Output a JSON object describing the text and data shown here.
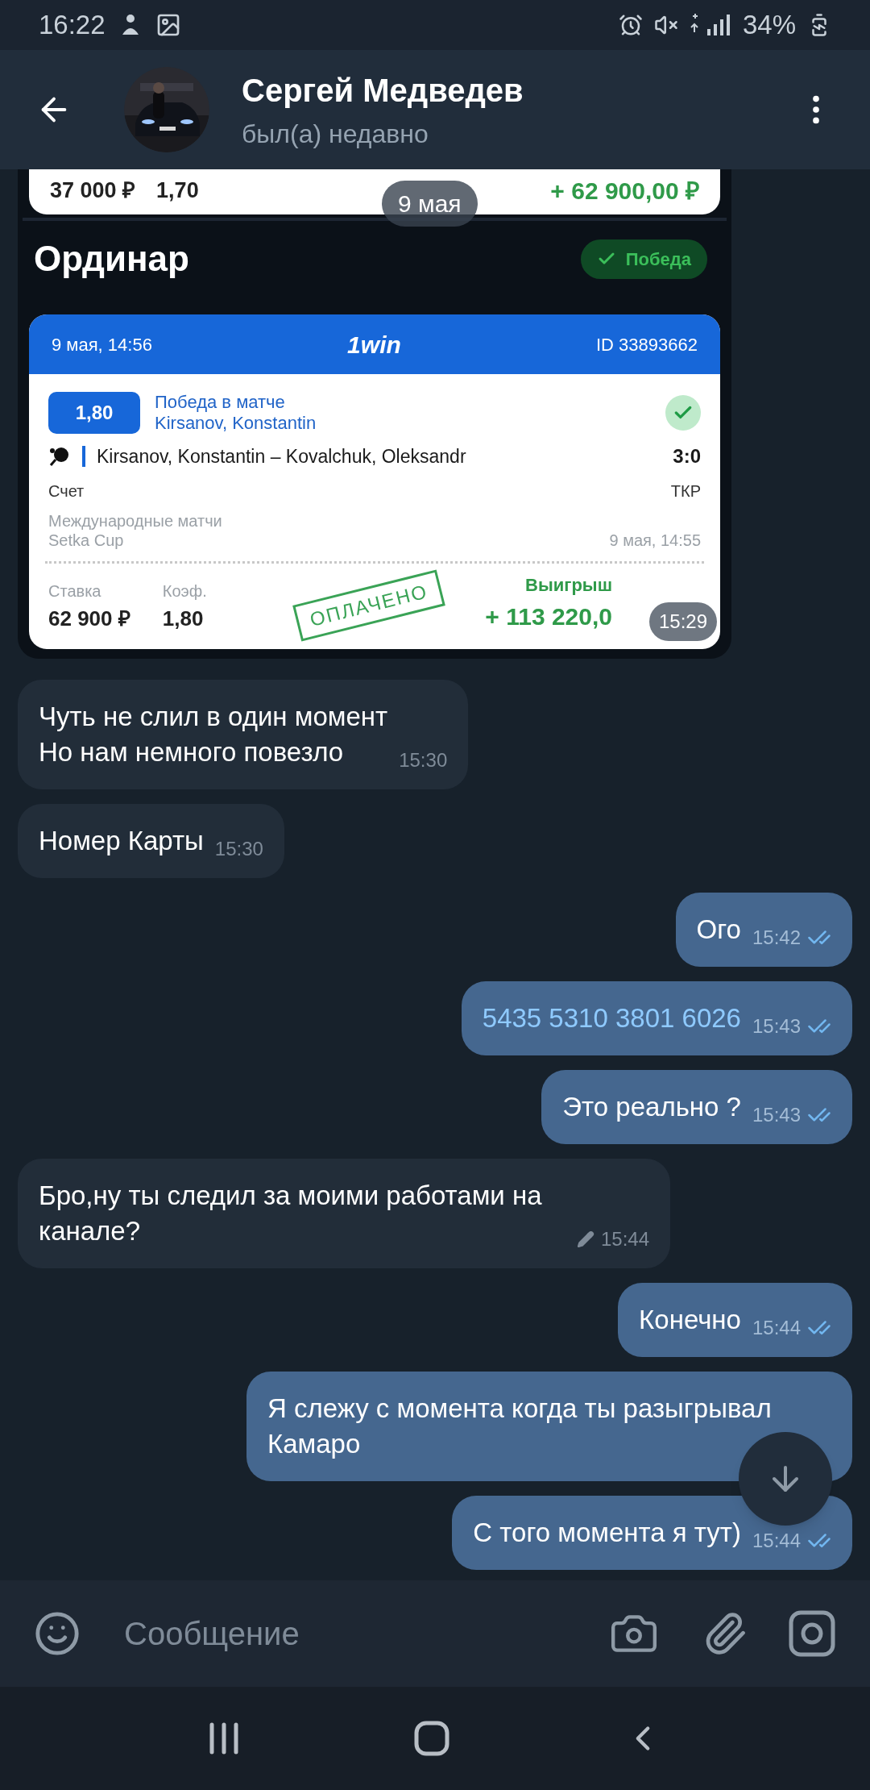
{
  "status_bar": {
    "time": "16:22",
    "battery": "34%"
  },
  "header": {
    "title": "Сергей Медведев",
    "subtitle": "был(а) недавно"
  },
  "date_badge": "9 мая",
  "messages": [
    {
      "outgoing": false,
      "time": "15:29",
      "prev_ticket": {
        "stake": "37 000 ₽",
        "coef": "1,70",
        "payout": "+ 62 900,00 ₽"
      },
      "ticket": {
        "title": "Ординар",
        "status": "Победа",
        "date": "9 мая, 14:56",
        "brand": "1win",
        "id": "ID 33893662",
        "odds": "1,80",
        "market": "Победа в матче",
        "selection": "Kirsanov, Konstantin",
        "match": "Kirsanov, Konstantin – Kovalchuk, Oleksandr",
        "score": "3:0",
        "score_label": "Счет",
        "score_status": "ТКР",
        "tournament": "Международные матчи",
        "league": "Setka Cup",
        "event_time": "9 мая, 14:55",
        "stake_label": "Ставка",
        "coef_label": "Коэф.",
        "stake": "62 900 ₽",
        "coef": "1,80",
        "payout_label": "Выигрыш",
        "payout": "+ 113 220,0",
        "stamp": "ОПЛАЧЕНО"
      }
    },
    {
      "kind": "text",
      "outgoing": false,
      "text": "Чуть не слил в один момент\nНо нам немного повезло",
      "time": "15:30",
      "edited": false
    },
    {
      "kind": "text",
      "outgoing": false,
      "text": "Номер Карты",
      "time": "15:30",
      "edited": false
    },
    {
      "kind": "text",
      "outgoing": true,
      "text": "Ого",
      "time": "15:42",
      "edited": false,
      "read": true,
      "link": false
    },
    {
      "kind": "text",
      "outgoing": true,
      "text": "5435 5310 3801 6026",
      "time": "15:43",
      "edited": false,
      "read": true,
      "link": true
    },
    {
      "kind": "text",
      "outgoing": true,
      "text": "Это реально ?",
      "time": "15:43",
      "edited": false,
      "read": true,
      "link": false
    },
    {
      "kind": "text",
      "outgoing": false,
      "text": "Бро,ну ты следил за моими работами на канале?",
      "time": "15:44",
      "edited": true
    },
    {
      "kind": "text",
      "outgoing": true,
      "text": "Конечно",
      "time": "15:44",
      "edited": false,
      "read": true,
      "link": false
    },
    {
      "kind": "text",
      "outgoing": true,
      "text": "Я слежу с момента когда ты разыгрывал Камаро",
      "edited": false,
      "link": false
    },
    {
      "kind": "text",
      "outgoing": true,
      "text": "С того момента я тут)",
      "time": "15:44",
      "edited": false,
      "read": true,
      "link": false
    }
  ],
  "composer": {
    "placeholder": "Сообщение"
  }
}
